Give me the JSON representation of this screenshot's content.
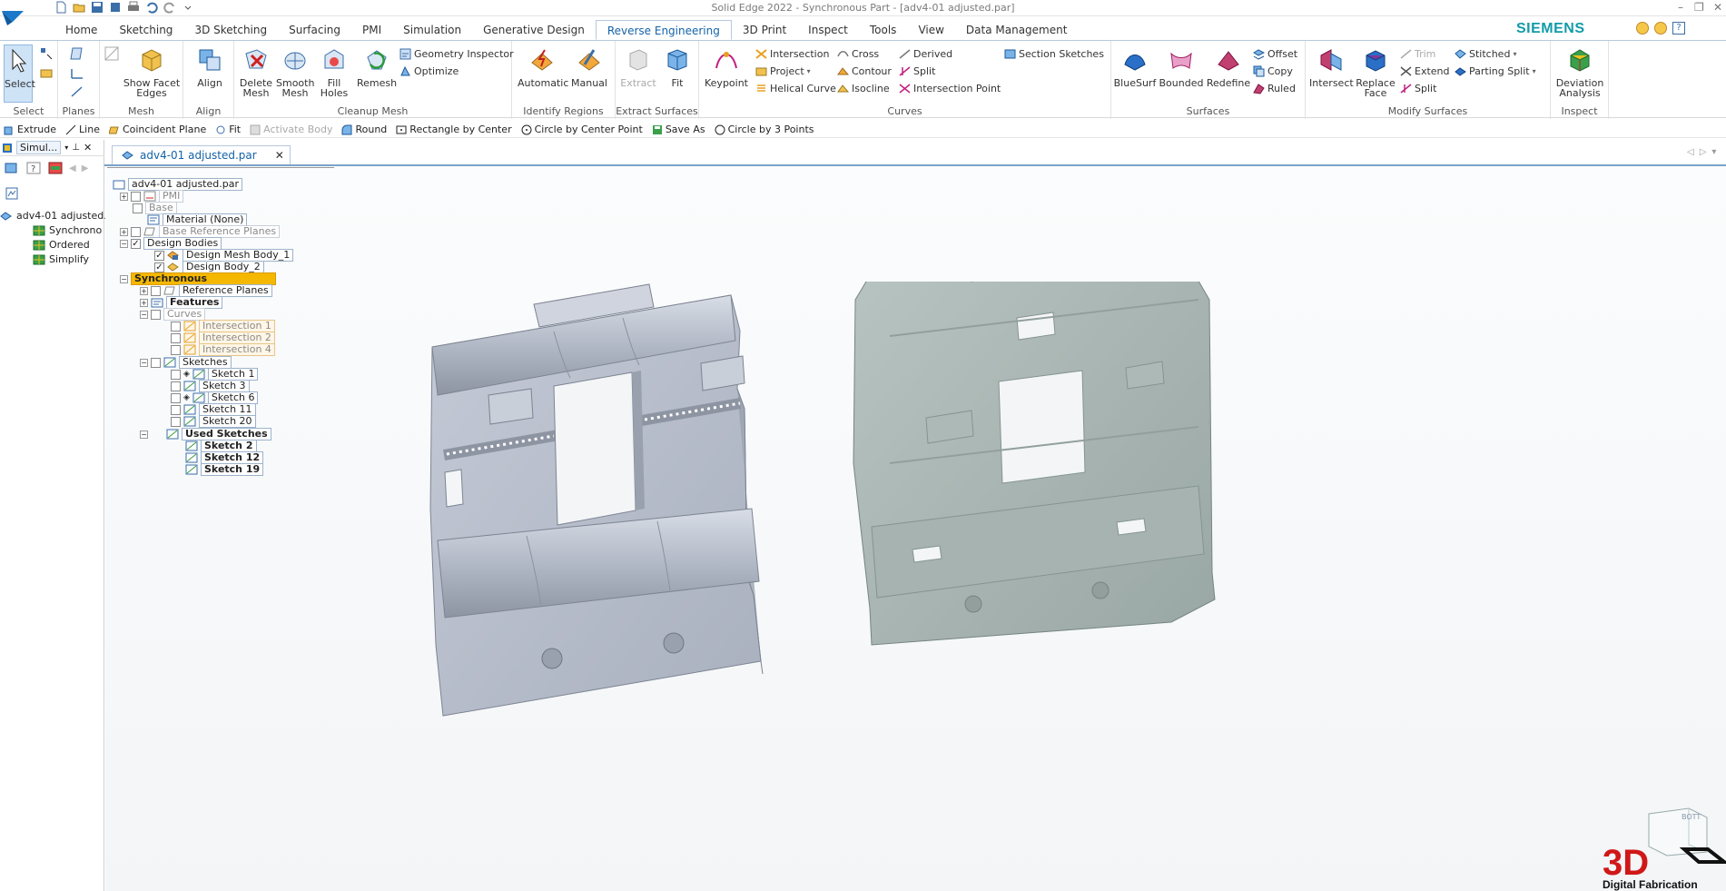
{
  "window": {
    "title": "Solid Edge 2022 - Synchronous Part - [adv4-01 adjusted.par]",
    "brand": "SIEMENS",
    "brand_color": "#119ba8",
    "accent_color": "#1463a8"
  },
  "tabs": [
    {
      "label": "Home"
    },
    {
      "label": "Sketching"
    },
    {
      "label": "3D Sketching"
    },
    {
      "label": "Surfacing"
    },
    {
      "label": "PMI"
    },
    {
      "label": "Simulation"
    },
    {
      "label": "Generative Design"
    },
    {
      "label": "Reverse Engineering",
      "active": true
    },
    {
      "label": "3D Print"
    },
    {
      "label": "Inspect"
    },
    {
      "label": "Tools"
    },
    {
      "label": "View"
    },
    {
      "label": "Data Management"
    }
  ],
  "ribbon": {
    "select": {
      "group": "Select",
      "select_label": "Select"
    },
    "planes": {
      "group": "Planes"
    },
    "mesh": {
      "group": "Mesh",
      "show_facet_edges_1": "Show Facet",
      "show_facet_edges_2": "Edges"
    },
    "align": {
      "group": "Align",
      "align_label": "Align"
    },
    "cleanup": {
      "group": "Cleanup Mesh",
      "delete_mesh_1": "Delete",
      "delete_mesh_2": "Mesh",
      "smooth_mesh_1": "Smooth",
      "smooth_mesh_2": "Mesh",
      "fill_holes_1": "Fill",
      "fill_holes_2": "Holes",
      "remesh": "Remesh",
      "geometry_inspector": "Geometry Inspector",
      "optimize": "Optimize"
    },
    "identify": {
      "group": "Identify Regions",
      "automatic": "Automatic",
      "manual": "Manual"
    },
    "extract": {
      "group": "Extract Surfaces",
      "extract": "Extract",
      "fit": "Fit"
    },
    "curves": {
      "group": "Curves",
      "keypoint": "Keypoint",
      "intersection": "Intersection",
      "project": "Project",
      "helical_curve": "Helical Curve",
      "cross": "Cross",
      "contour": "Contour",
      "isocline": "Isocline",
      "derived": "Derived",
      "split": "Split",
      "intersection_point": "Intersection Point",
      "section_sketches": "Section Sketches"
    },
    "surfaces": {
      "group": "Surfaces",
      "bluesurf": "BlueSurf",
      "bounded": "Bounded",
      "redefine": "Redefine",
      "offset": "Offset",
      "copy": "Copy",
      "ruled": "Ruled"
    },
    "modify": {
      "group": "Modify Surfaces",
      "intersect": "Intersect",
      "replace_face_1": "Replace",
      "replace_face_2": "Face",
      "trim": "Trim",
      "extend": "Extend",
      "split": "Split",
      "stitched": "Stitched",
      "parting_split": "Parting Split"
    },
    "inspect": {
      "group": "Inspect",
      "deviation_1": "Deviation",
      "deviation_2": "Analysis"
    }
  },
  "commandbar": [
    {
      "label": "Extrude"
    },
    {
      "label": "Line"
    },
    {
      "label": "Coincident Plane"
    },
    {
      "label": "Fit"
    },
    {
      "label": "Activate Body",
      "disabled": true
    },
    {
      "label": "Round"
    },
    {
      "label": "Rectangle by Center"
    },
    {
      "label": "Circle by Center Point"
    },
    {
      "label": "Save As"
    },
    {
      "label": "Circle by 3 Points"
    }
  ],
  "leftpane": {
    "tab_label": "Simul...",
    "root": "adv4-01 adjusted.p",
    "items": [
      "Synchrono",
      "Ordered",
      "Simplify"
    ]
  },
  "document": {
    "tab_label": "adv4-01 adjusted.par"
  },
  "tree": {
    "root": "adv4-01 adjusted.par",
    "pmi": "PMI",
    "base": "Base",
    "material": "Material (None)",
    "base_ref_planes": "Base Reference Planes",
    "design_bodies": "Design Bodies",
    "design_mesh_body": "Design Mesh Body_1",
    "design_body_2": "Design Body_2",
    "synchronous": "Synchronous",
    "reference_planes": "Reference Planes",
    "features": "Features",
    "curves": "Curves",
    "intersection_1": "Intersection 1",
    "intersection_2": "Intersection 2",
    "intersection_4": "Intersection 4",
    "sketches": "Sketches",
    "sketch_1": "Sketch 1",
    "sketch_3": "Sketch 3",
    "sketch_6": "Sketch 6",
    "sketch_11": "Sketch 11",
    "sketch_20": "Sketch 20",
    "used_sketches": "Used Sketches",
    "sketch_2": "Sketch 2",
    "sketch_12": "Sketch 12",
    "sketch_19": "Sketch 19"
  },
  "viewcube": {
    "label": "BOTT"
  },
  "watermark": {
    "line1": "3D",
    "line2": "Digital Fabrication"
  }
}
